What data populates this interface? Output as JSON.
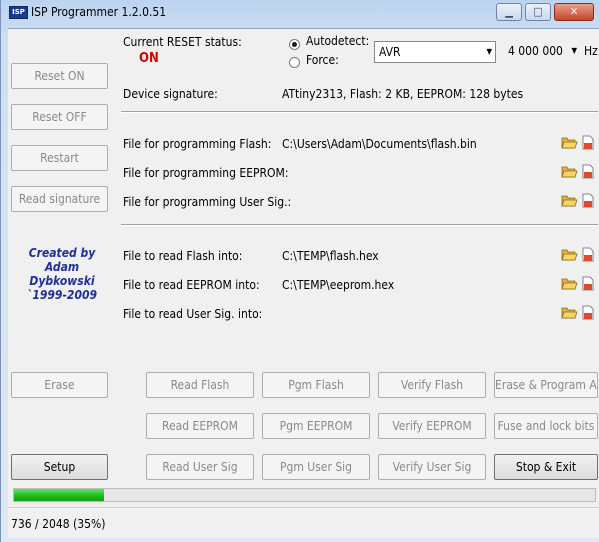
{
  "window": {
    "title": "ISP Programmer 1.2.0.51",
    "app_icon": "ISP",
    "min_glyph": "▁",
    "max_glyph": "□",
    "close_glyph": "✕"
  },
  "left_buttons": {
    "reset_on": "Reset ON",
    "reset_off": "Reset OFF",
    "restart": "Restart",
    "read_signature": "Read signature",
    "erase": "Erase",
    "setup": "Setup"
  },
  "reset": {
    "label": "Current RESET status:",
    "value": "ON",
    "value_color": "#d40000"
  },
  "detect": {
    "autodetect_label": "Autodetect:",
    "force_label": "Force:",
    "selected": "autodetect",
    "family": "AVR",
    "clock": "4 000 000",
    "clock_unit": "Hz"
  },
  "signature": {
    "label": "Device signature:",
    "value": "ATtiny2313, Flash: 2 KB, EEPROM: 128 bytes"
  },
  "program_files": [
    {
      "label": "File for programming Flash:",
      "path": "C:\\Users\\Adam\\Documents\\flash.bin"
    },
    {
      "label": "File for programming EEPROM:",
      "path": ""
    },
    {
      "label": "File for programming User Sig.:",
      "path": ""
    }
  ],
  "read_files": [
    {
      "label": "File to read Flash into:",
      "path": "C:\\TEMP\\flash.hex"
    },
    {
      "label": "File to read EEPROM into:",
      "path": "C:\\TEMP\\eeprom.hex"
    },
    {
      "label": "File to read User Sig. into:",
      "path": ""
    }
  ],
  "credit": {
    "line1": "Created by",
    "line2": "Adam",
    "line3": "Dybkowski",
    "line4": "`1999-2009"
  },
  "actions": {
    "read_flash": "Read Flash",
    "pgm_flash": "Pgm Flash",
    "verify_flash": "Verify Flash",
    "erase_program_all": "Erase & Program All",
    "read_eeprom": "Read EEPROM",
    "pgm_eeprom": "Pgm EEPROM",
    "verify_eeprom": "Verify EEPROM",
    "fuse_lock": "Fuse and lock bits",
    "read_user_sig": "Read User Sig",
    "pgm_user_sig": "Pgm User Sig",
    "verify_user_sig": "Verify User Sig",
    "stop_exit": "Stop & Exit"
  },
  "progress": {
    "fraction": 0.1553,
    "fill_color": "#1fb51f",
    "status_text": "736 / 2048 (35%)"
  },
  "icons": {
    "open": "folder-open-icon",
    "clear": "clear-document-icon"
  }
}
